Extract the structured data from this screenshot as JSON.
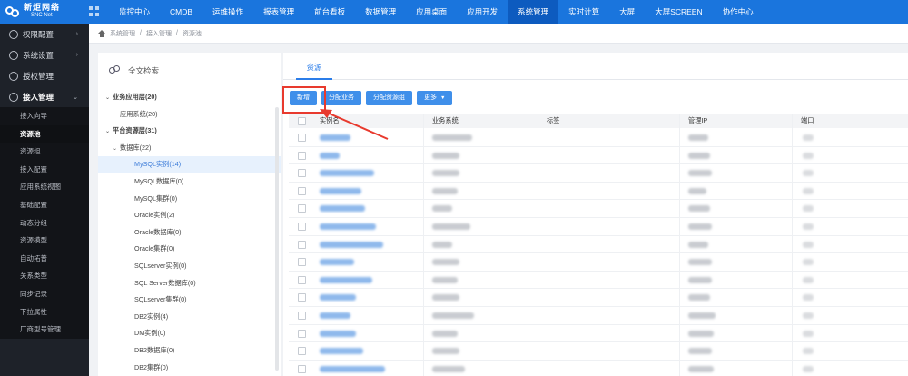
{
  "brand": {
    "name_cn": "新炬网络",
    "name_en": "SNC Net"
  },
  "topnav": [
    {
      "label": "监控中心"
    },
    {
      "label": "CMDB"
    },
    {
      "label": "运维操作"
    },
    {
      "label": "报表管理"
    },
    {
      "label": "前台看板"
    },
    {
      "label": "数据管理"
    },
    {
      "label": "应用桌面"
    },
    {
      "label": "应用开发"
    },
    {
      "label": "系统管理",
      "active": true
    },
    {
      "label": "实时计算"
    },
    {
      "label": "大屏"
    },
    {
      "label": "大屏SCREEN"
    },
    {
      "label": "协作中心"
    }
  ],
  "sidebar": {
    "groups": [
      {
        "label": "权限配置",
        "icon": "user-icon",
        "arrow": "›"
      },
      {
        "label": "系统设置",
        "icon": "settings-icon",
        "arrow": "›"
      },
      {
        "label": "授权管理",
        "icon": "license-icon",
        "arrow": ""
      },
      {
        "label": "接入管理",
        "icon": "access-icon",
        "arrow": "⌄",
        "open": true
      }
    ],
    "items": [
      {
        "label": "接入向导"
      },
      {
        "label": "资源池",
        "active": true
      },
      {
        "label": "资源组"
      },
      {
        "label": "接入配置"
      },
      {
        "label": "应用系统视图"
      },
      {
        "label": "基础配置"
      },
      {
        "label": "动态分组"
      },
      {
        "label": "资源模型"
      },
      {
        "label": "自动拓普"
      },
      {
        "label": "关系类型"
      },
      {
        "label": "同步记录"
      },
      {
        "label": "下拉属性"
      },
      {
        "label": "厂商型号管理"
      }
    ]
  },
  "breadcrumb": [
    "系统管理",
    "接入管理",
    "资源池"
  ],
  "tree": {
    "search_label": "全文检索",
    "nodes": [
      {
        "label": "业务应用层(20)",
        "level": 0,
        "caret": "⌄"
      },
      {
        "label": "应用系统(20)",
        "level": 1,
        "caret": ""
      },
      {
        "label": "平台资源层(31)",
        "level": 0,
        "caret": "⌄"
      },
      {
        "label": "数据库(22)",
        "level": 1,
        "caret": "⌄"
      },
      {
        "label": "MySQL实例(14)",
        "level": 2,
        "selected": true
      },
      {
        "label": "MySQL数据库(0)",
        "level": 2
      },
      {
        "label": "MySQL集群(0)",
        "level": 2
      },
      {
        "label": "Oracle实例(2)",
        "level": 2
      },
      {
        "label": "Oracle数据库(0)",
        "level": 2
      },
      {
        "label": "Oracle集群(0)",
        "level": 2
      },
      {
        "label": "SQLserver实例(0)",
        "level": 2
      },
      {
        "label": "SQL Server数据库(0)",
        "level": 2
      },
      {
        "label": "SQLserver集群(0)",
        "level": 2
      },
      {
        "label": "DB2实例(4)",
        "level": 2
      },
      {
        "label": "DM实例(0)",
        "level": 2
      },
      {
        "label": "DB2数据库(0)",
        "level": 2
      },
      {
        "label": "DB2集群(0)",
        "level": 2
      }
    ]
  },
  "tabs": [
    {
      "label": "资源"
    }
  ],
  "toolbar": {
    "add": "新增",
    "assign_business": "分配业务",
    "assign_group": "分配资源组",
    "more": "更多"
  },
  "table": {
    "columns": [
      "实例名",
      "业务系统",
      "标签",
      "管理IP",
      "端口"
    ],
    "row_count": 14
  },
  "colors": {
    "primary": "#1a75dd",
    "button": "#3f8fea",
    "annotation": "#e83a2e",
    "sidebar": "#1e2229"
  }
}
